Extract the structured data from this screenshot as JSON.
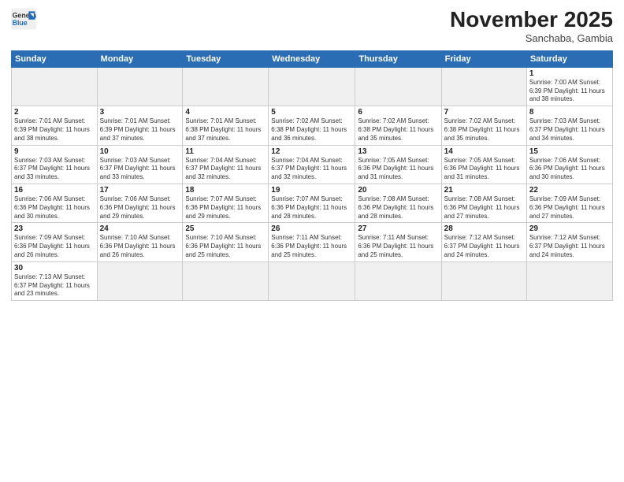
{
  "header": {
    "logo_general": "General",
    "logo_blue": "Blue",
    "month_title": "November 2025",
    "subtitle": "Sanchaba, Gambia"
  },
  "days_of_week": [
    "Sunday",
    "Monday",
    "Tuesday",
    "Wednesday",
    "Thursday",
    "Friday",
    "Saturday"
  ],
  "weeks": [
    [
      {
        "day": "",
        "info": ""
      },
      {
        "day": "",
        "info": ""
      },
      {
        "day": "",
        "info": ""
      },
      {
        "day": "",
        "info": ""
      },
      {
        "day": "",
        "info": ""
      },
      {
        "day": "",
        "info": ""
      },
      {
        "day": "1",
        "info": "Sunrise: 7:00 AM\nSunset: 6:39 PM\nDaylight: 11 hours\nand 38 minutes."
      }
    ],
    [
      {
        "day": "2",
        "info": "Sunrise: 7:01 AM\nSunset: 6:39 PM\nDaylight: 11 hours\nand 38 minutes."
      },
      {
        "day": "3",
        "info": "Sunrise: 7:01 AM\nSunset: 6:39 PM\nDaylight: 11 hours\nand 37 minutes."
      },
      {
        "day": "4",
        "info": "Sunrise: 7:01 AM\nSunset: 6:38 PM\nDaylight: 11 hours\nand 37 minutes."
      },
      {
        "day": "5",
        "info": "Sunrise: 7:02 AM\nSunset: 6:38 PM\nDaylight: 11 hours\nand 36 minutes."
      },
      {
        "day": "6",
        "info": "Sunrise: 7:02 AM\nSunset: 6:38 PM\nDaylight: 11 hours\nand 35 minutes."
      },
      {
        "day": "7",
        "info": "Sunrise: 7:02 AM\nSunset: 6:38 PM\nDaylight: 11 hours\nand 35 minutes."
      },
      {
        "day": "8",
        "info": "Sunrise: 7:03 AM\nSunset: 6:37 PM\nDaylight: 11 hours\nand 34 minutes."
      }
    ],
    [
      {
        "day": "9",
        "info": "Sunrise: 7:03 AM\nSunset: 6:37 PM\nDaylight: 11 hours\nand 33 minutes."
      },
      {
        "day": "10",
        "info": "Sunrise: 7:03 AM\nSunset: 6:37 PM\nDaylight: 11 hours\nand 33 minutes."
      },
      {
        "day": "11",
        "info": "Sunrise: 7:04 AM\nSunset: 6:37 PM\nDaylight: 11 hours\nand 32 minutes."
      },
      {
        "day": "12",
        "info": "Sunrise: 7:04 AM\nSunset: 6:37 PM\nDaylight: 11 hours\nand 32 minutes."
      },
      {
        "day": "13",
        "info": "Sunrise: 7:05 AM\nSunset: 6:36 PM\nDaylight: 11 hours\nand 31 minutes."
      },
      {
        "day": "14",
        "info": "Sunrise: 7:05 AM\nSunset: 6:36 PM\nDaylight: 11 hours\nand 31 minutes."
      },
      {
        "day": "15",
        "info": "Sunrise: 7:06 AM\nSunset: 6:36 PM\nDaylight: 11 hours\nand 30 minutes."
      }
    ],
    [
      {
        "day": "16",
        "info": "Sunrise: 7:06 AM\nSunset: 6:36 PM\nDaylight: 11 hours\nand 30 minutes."
      },
      {
        "day": "17",
        "info": "Sunrise: 7:06 AM\nSunset: 6:36 PM\nDaylight: 11 hours\nand 29 minutes."
      },
      {
        "day": "18",
        "info": "Sunrise: 7:07 AM\nSunset: 6:36 PM\nDaylight: 11 hours\nand 29 minutes."
      },
      {
        "day": "19",
        "info": "Sunrise: 7:07 AM\nSunset: 6:36 PM\nDaylight: 11 hours\nand 28 minutes."
      },
      {
        "day": "20",
        "info": "Sunrise: 7:08 AM\nSunset: 6:36 PM\nDaylight: 11 hours\nand 28 minutes."
      },
      {
        "day": "21",
        "info": "Sunrise: 7:08 AM\nSunset: 6:36 PM\nDaylight: 11 hours\nand 27 minutes."
      },
      {
        "day": "22",
        "info": "Sunrise: 7:09 AM\nSunset: 6:36 PM\nDaylight: 11 hours\nand 27 minutes."
      }
    ],
    [
      {
        "day": "23",
        "info": "Sunrise: 7:09 AM\nSunset: 6:36 PM\nDaylight: 11 hours\nand 26 minutes."
      },
      {
        "day": "24",
        "info": "Sunrise: 7:10 AM\nSunset: 6:36 PM\nDaylight: 11 hours\nand 26 minutes."
      },
      {
        "day": "25",
        "info": "Sunrise: 7:10 AM\nSunset: 6:36 PM\nDaylight: 11 hours\nand 25 minutes."
      },
      {
        "day": "26",
        "info": "Sunrise: 7:11 AM\nSunset: 6:36 PM\nDaylight: 11 hours\nand 25 minutes."
      },
      {
        "day": "27",
        "info": "Sunrise: 7:11 AM\nSunset: 6:36 PM\nDaylight: 11 hours\nand 25 minutes."
      },
      {
        "day": "28",
        "info": "Sunrise: 7:12 AM\nSunset: 6:37 PM\nDaylight: 11 hours\nand 24 minutes."
      },
      {
        "day": "29",
        "info": "Sunrise: 7:12 AM\nSunset: 6:37 PM\nDaylight: 11 hours\nand 24 minutes."
      }
    ],
    [
      {
        "day": "30",
        "info": "Sunrise: 7:13 AM\nSunset: 6:37 PM\nDaylight: 11 hours\nand 23 minutes."
      },
      {
        "day": "",
        "info": ""
      },
      {
        "day": "",
        "info": ""
      },
      {
        "day": "",
        "info": ""
      },
      {
        "day": "",
        "info": ""
      },
      {
        "day": "",
        "info": ""
      },
      {
        "day": "",
        "info": ""
      }
    ]
  ]
}
